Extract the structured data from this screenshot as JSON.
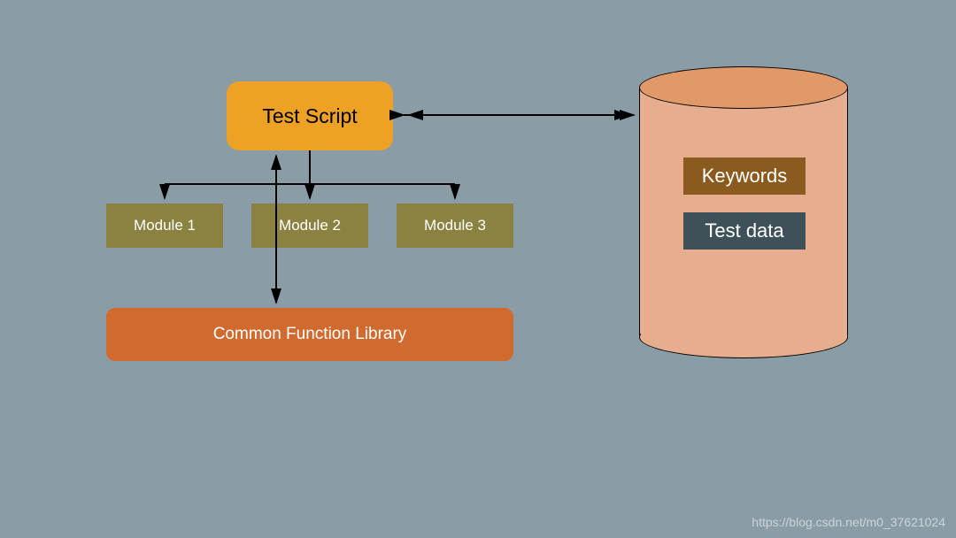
{
  "diagram": {
    "test_script": "Test Script",
    "modules": [
      "Module 1",
      "Module 2",
      "Module 3"
    ],
    "library": "Common Function Library",
    "cylinder": {
      "keywords": "Keywords",
      "test_data": "Test data"
    }
  },
  "colors": {
    "background": "#8a9da6",
    "test_script_bg": "#eda125",
    "module_bg": "#8b8141",
    "library_bg": "#d06a2f",
    "cylinder_body": "#e6ae8e",
    "cylinder_top": "#e19969",
    "keywords_bg": "#8a5a1f",
    "testdata_bg": "#3e5158"
  },
  "watermark": "https://blog.csdn.net/m0_37621024"
}
